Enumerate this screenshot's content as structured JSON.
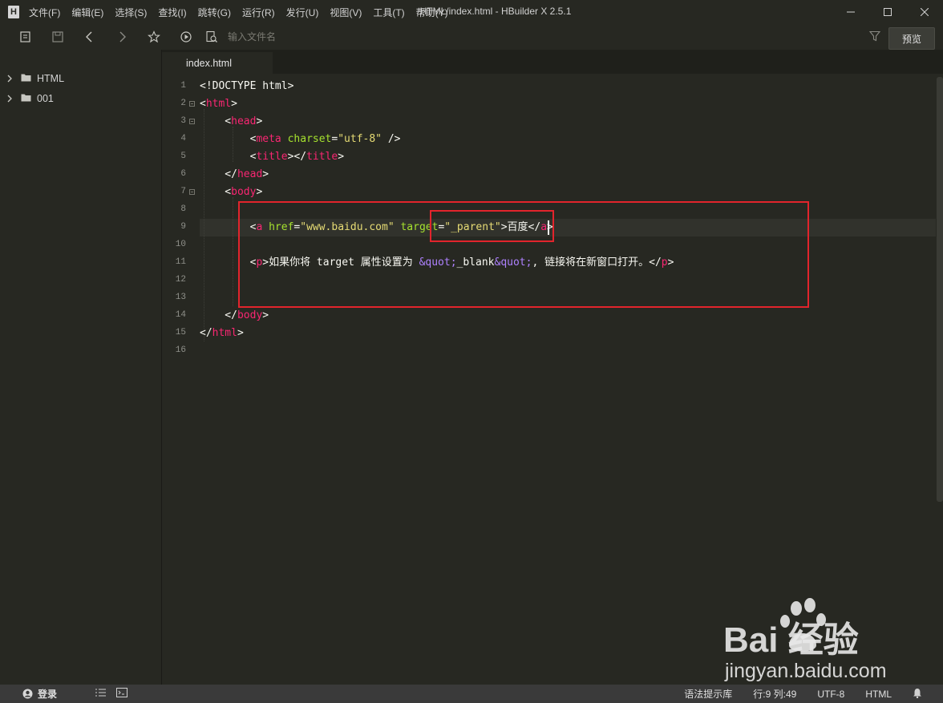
{
  "app": {
    "logo_letter": "H",
    "window_title": "HTML/index.html - HBuilder X 2.5.1"
  },
  "menu": [
    {
      "label": "文件(F)"
    },
    {
      "label": "编辑(E)"
    },
    {
      "label": "选择(S)"
    },
    {
      "label": "查找(I)"
    },
    {
      "label": "跳转(G)"
    },
    {
      "label": "运行(R)"
    },
    {
      "label": "发行(U)"
    },
    {
      "label": "视图(V)"
    },
    {
      "label": "工具(T)"
    },
    {
      "label": "帮助(Y)"
    }
  ],
  "toolbar": {
    "icons": [
      "new-file-icon",
      "save-icon",
      "back-icon",
      "forward-icon",
      "star-icon",
      "run-icon"
    ],
    "search_placeholder": "输入文件名",
    "preview_label": "预览"
  },
  "sidebar": {
    "items": [
      {
        "label": "HTML",
        "icon": "folder-icon"
      },
      {
        "label": "001",
        "icon": "folder-icon"
      }
    ]
  },
  "tabs": [
    {
      "label": "index.html",
      "active": true
    }
  ],
  "editor": {
    "line_numbers": [
      "1",
      "2",
      "3",
      "4",
      "5",
      "6",
      "7",
      "8",
      "9",
      "10",
      "11",
      "12",
      "13",
      "14",
      "15",
      "16"
    ],
    "current_line": 9
  },
  "statusbar": {
    "login_label": "登录",
    "syntax_lib": "语法提示库",
    "position": "行:9   列:49",
    "encoding": "UTF-8",
    "language": "HTML"
  },
  "watermark": {
    "brand_text": "Bai  经验",
    "url": "jingyan.baidu.com"
  },
  "colors": {
    "background": "#272822",
    "tag": "#f92672",
    "attribute": "#a6e22e",
    "string": "#e6db74",
    "entity": "#ae81ff",
    "annotation_box": "#e2242c"
  }
}
